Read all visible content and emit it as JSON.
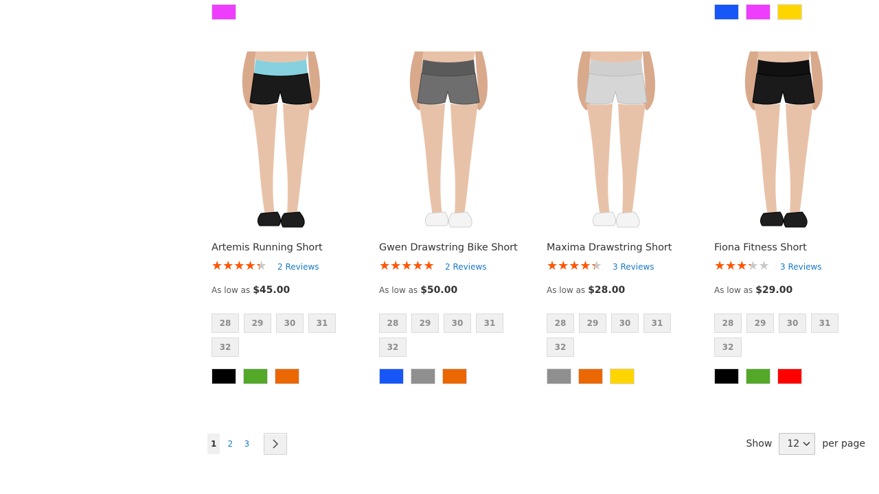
{
  "top_swatches": [
    {
      "colors": [
        "#ef3dff"
      ]
    },
    {
      "colors": [
        "#1857f7",
        "#ef3dff",
        "#ffd500"
      ]
    }
  ],
  "products": [
    {
      "name": "Artemis Running Short",
      "rating": 4,
      "reviews_label": "2 Reviews",
      "price_prefix": "As low as",
      "price": "$45.00",
      "sizes": [
        "28",
        "29",
        "30",
        "31",
        "32"
      ],
      "colors": [
        "#000000",
        "#53a828",
        "#eb6703"
      ],
      "image": {
        "garment": "black",
        "waistband": "#86d0df",
        "shoes": "black",
        "icon": "product-image-artemis"
      }
    },
    {
      "name": "Gwen Drawstring Bike Short",
      "rating": 4.5,
      "reviews_label": "2 Reviews",
      "price_prefix": "As low as",
      "price": "$50.00",
      "sizes": [
        "28",
        "29",
        "30",
        "31",
        "32"
      ],
      "colors": [
        "#1857f7",
        "#8f8f8f",
        "#eb6703"
      ],
      "image": {
        "garment": "heather-gray",
        "waistband": "#5a5a5a",
        "shoes": "white",
        "icon": "product-image-gwen"
      }
    },
    {
      "name": "Maxima Drawstring Short",
      "rating": 4,
      "reviews_label": "3 Reviews",
      "price_prefix": "As low as",
      "price": "$28.00",
      "sizes": [
        "28",
        "29",
        "30",
        "31",
        "32"
      ],
      "colors": [
        "#8f8f8f",
        "#eb6703",
        "#ffd500"
      ],
      "image": {
        "garment": "light-gray",
        "waistband": "#cfcfcf",
        "shoes": "white",
        "icon": "product-image-maxima"
      }
    },
    {
      "name": "Fiona Fitness Short",
      "rating": 3,
      "reviews_label": "3 Reviews",
      "price_prefix": "As low as",
      "price": "$29.00",
      "sizes": [
        "28",
        "29",
        "30",
        "31",
        "32"
      ],
      "colors": [
        "#000000",
        "#53a828",
        "#ff0000"
      ],
      "image": {
        "garment": "black",
        "waistband": "#111111",
        "shoes": "black",
        "icon": "product-image-fiona"
      }
    }
  ],
  "pager": {
    "pages": [
      "1",
      "2",
      "3"
    ],
    "current": "1",
    "next_icon": "chevron-right-icon"
  },
  "limiter": {
    "show_label": "Show",
    "value": "12",
    "per_page_label": "per page"
  },
  "accent": {
    "star": "#ff5501",
    "link": "#1979c3"
  }
}
